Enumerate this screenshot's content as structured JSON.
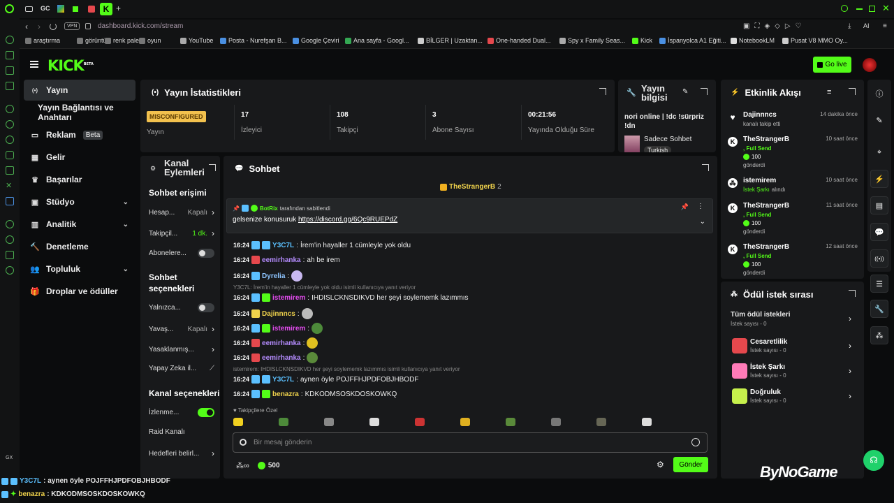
{
  "browser": {
    "url": "dashboard.kick.com/stream",
    "tabs": [
      "GC"
    ],
    "bookmarks": [
      "araştırma",
      "görüntü",
      "renk paleti",
      "oyun",
      "YouTube",
      "Posta - Nurefşan B...",
      "Google Çeviri",
      "Ana sayfa - Googl...",
      "BİLGER | Uzaktan...",
      "One-handed Dual...",
      "Spy x Family Seas...",
      "Kick",
      "İspanyolca A1 Eğiti...",
      "NotebookLM",
      "Pusat V8 MMO Oy..."
    ],
    "ai_label": "AI",
    "gx_label": "GX"
  },
  "header": {
    "logo": "KICK",
    "logo_beta": "BETA",
    "go_live": "Go live"
  },
  "nav": {
    "items": [
      {
        "label": "Yayın",
        "icon": "stream-icon",
        "active": true
      },
      {
        "label": "Yayın Bağlantısı ve Anahtarı",
        "icon": "",
        "active": false
      },
      {
        "label": "Reklam",
        "icon": "ad-icon",
        "badge": "Beta"
      },
      {
        "label": "Gelir",
        "icon": "revenue-icon"
      },
      {
        "label": "Başarılar",
        "icon": "trophy-icon"
      },
      {
        "label": "Stüdyo",
        "icon": "studio-icon",
        "chevron": true
      },
      {
        "label": "Analitik",
        "icon": "analytics-icon",
        "chevron": true
      },
      {
        "label": "Denetleme",
        "icon": "moderation-icon"
      },
      {
        "label": "Topluluk",
        "icon": "community-icon",
        "chevron": true
      },
      {
        "label": "Droplar ve ödüller",
        "icon": "drops-icon"
      }
    ]
  },
  "stats": {
    "title": "Yayın İstatistikleri",
    "items": [
      {
        "value": "MISCONFIGURED",
        "label": "Yayın"
      },
      {
        "value": "17",
        "label": "İzleyici"
      },
      {
        "value": "108",
        "label": "Takipçi"
      },
      {
        "value": "3",
        "label": "Abone Sayısı"
      },
      {
        "value": "00:21:56",
        "label": "Yayında Olduğu Süre"
      }
    ]
  },
  "stream_info": {
    "title": "Yayın bilgisi",
    "stream_title": "nori online | !dc !sürpriz !dn",
    "category": "Sadece Sohbet",
    "language": "Turkish"
  },
  "channel_actions": {
    "title": "Kanal Eylemleri",
    "chat_access": "Sohbet erişimi",
    "rows1": [
      {
        "label": "Hesap...",
        "value": "Kapalı",
        "type": "chevron"
      },
      {
        "label": "Takipçil...",
        "value": "1 dk.",
        "type": "chevron",
        "green": true
      },
      {
        "label": "Abonelere...",
        "value": "",
        "type": "toggle",
        "on": false
      }
    ],
    "chat_options": "Sohbet seçenekleri",
    "rows2": [
      {
        "label": "Yalnızca...",
        "value": "",
        "type": "toggle",
        "on": false
      },
      {
        "label": "Yavaş...",
        "value": "Kapalı",
        "type": "chevron"
      },
      {
        "label": "Yasaklanmış...",
        "value": "",
        "type": "chevron"
      },
      {
        "label": "Yapay Zeka il...",
        "value": "",
        "type": "chart"
      }
    ],
    "channel_options": "Kanal seçenekleri",
    "rows3": [
      {
        "label": "İzlenme...",
        "value": "",
        "type": "toggle",
        "on": true
      },
      {
        "label": "Raid Kanalı",
        "value": "",
        "type": "none"
      },
      {
        "label": "Hedefleri belirl...",
        "value": "",
        "type": "chevron"
      }
    ]
  },
  "chat": {
    "title": "Sohbet",
    "top_gifter": "TheStrangerB",
    "top_gifter_count": "2",
    "pinned_by": "BotRix",
    "pinned_suffix": "tarafından sabitlendi",
    "pinned_text": "gelsenize konusuruk",
    "pinned_link": "https://discord.gg/6Qc9RUEPdZ",
    "messages": [
      {
        "time": "16:24",
        "user": "Y3C7L",
        "color": "#5bc0ff",
        "text": "İrem'in hayaller 1 cümleyle yok oldu"
      },
      {
        "time": "16:24",
        "user": "eemirhanka",
        "color": "#b58cff",
        "text": "ah be irem"
      },
      {
        "time": "16:24",
        "user": "Dyrelia",
        "color": "#8ec5ff",
        "text": ""
      },
      {
        "time": "16:24",
        "user": "istemirem",
        "color": "#e44cf0",
        "text": "IHDISLCKNSDIKVD her şeyi soylememk lazımmıs",
        "reply": "Y3C7L: İrem'in hayaller 1 cümleyle yok oldu isimli kullanıcıya yanıt veriyor"
      },
      {
        "time": "16:24",
        "user": "Dajinnncs",
        "color": "#f0d34c",
        "text": ""
      },
      {
        "time": "16:24",
        "user": "istemirem",
        "color": "#e44cf0",
        "text": ""
      },
      {
        "time": "16:24",
        "user": "eemirhanka",
        "color": "#b58cff",
        "text": ""
      },
      {
        "time": "16:24",
        "user": "eemirhanka",
        "color": "#b58cff",
        "text": ""
      },
      {
        "time": "16:24",
        "user": "Y3C7L",
        "color": "#5bc0ff",
        "text": "aynen öyle POJFFHJPDFOBJHBODF",
        "reply": "istemirem: IHDISLCKNSDIKVD her şeyi soylememk lazımmıs isimli kullanıcıya yanıt veriyor"
      },
      {
        "time": "16:24",
        "user": "benazra",
        "color": "#f0d34c",
        "text": "KDKODMSOSKDOSKOWKQ"
      }
    ],
    "followers_only": "Takipçilere Özel",
    "input_placeholder": "Bir mesaj gönderin",
    "points": "500",
    "send": "Gönder"
  },
  "activity": {
    "title": "Etkinlik Akışı",
    "events": [
      {
        "name": "Dajinnncs",
        "time": "14 dakika önce",
        "line1": "kanalı takip etti",
        "icon": "heart"
      },
      {
        "name": "TheStrangerB",
        "time": "10 saat önce",
        "line1": ", Full Send",
        "amount": "100",
        "line3": "gönderdi",
        "icon": "kick"
      },
      {
        "name": "istemirem",
        "time": "10 saat önce",
        "line1": "İstek Şarkı",
        "line1b": "alındı",
        "icon": "reward"
      },
      {
        "name": "TheStrangerB",
        "time": "11 saat önce",
        "line1": ", Full Send",
        "amount": "100",
        "line3": "gönderdi",
        "icon": "kick"
      },
      {
        "name": "TheStrangerB",
        "time": "12 saat önce",
        "line1": ", Full Send",
        "amount": "100",
        "line3": "gönderdi",
        "icon": "kick"
      }
    ]
  },
  "rewards": {
    "title": "Ödül istek sırası",
    "all_label": "Tüm ödül istekleri",
    "all_count": "İstek sayısı - 0",
    "items": [
      {
        "name": "Cesaretlilik",
        "count": "İstek sayısı - 0",
        "color": "#e5484d"
      },
      {
        "name": "İstek Şarkı",
        "count": "İstek sayısı - 0",
        "color": "#ff7bb8"
      },
      {
        "name": "Doğruluk",
        "count": "İstek sayısı - 0",
        "color": "#c6f04c"
      }
    ]
  },
  "overlay": {
    "watermark": "ByNoGame",
    "line1_user": "Y3C7L",
    "line1_text": ": aynen öyle POJFFHJPDFOBJHBODF",
    "line2_user": "benazra",
    "line2_text": ": KDKODMSOSKDOSKOWKQ"
  }
}
